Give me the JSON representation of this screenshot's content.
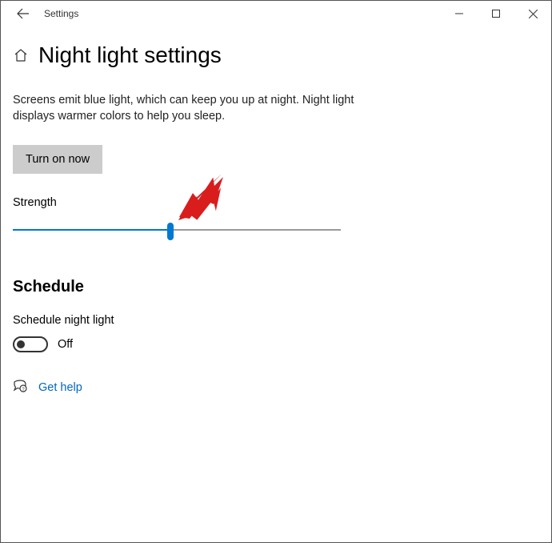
{
  "window": {
    "title": "Settings"
  },
  "page": {
    "title": "Night light settings",
    "description": "Screens emit blue light, which can keep you up at night. Night light displays warmer colors to help you sleep."
  },
  "turn_on": {
    "label": "Turn on now"
  },
  "slider": {
    "label": "Strength",
    "percent": 48
  },
  "schedule": {
    "heading": "Schedule",
    "toggle_label": "Schedule night light",
    "state_label": "Off"
  },
  "help": {
    "label": "Get help"
  }
}
